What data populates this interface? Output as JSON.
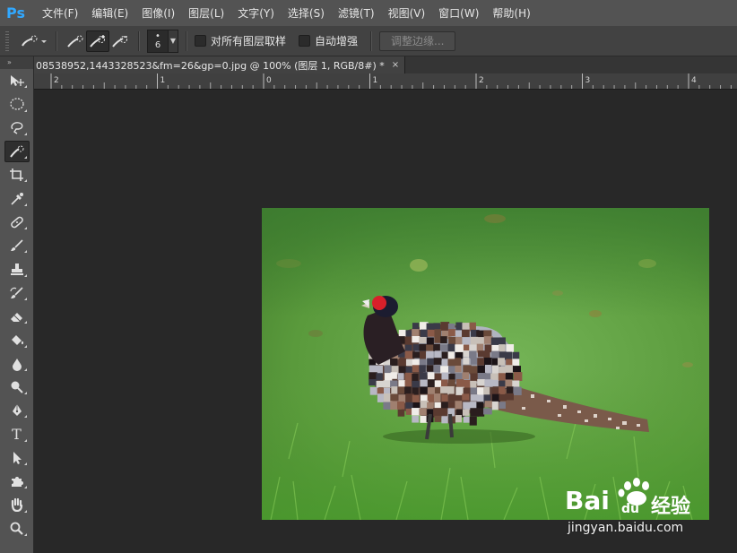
{
  "app": {
    "logo": "Ps"
  },
  "menu": {
    "items": [
      "文件(F)",
      "编辑(E)",
      "图像(I)",
      "图层(L)",
      "文字(Y)",
      "选择(S)",
      "滤镜(T)",
      "视图(V)",
      "窗口(W)",
      "帮助(H)"
    ]
  },
  "options": {
    "brush_size": "6",
    "sample_all_layers": "对所有图层取样",
    "auto_enhance": "自动增强",
    "refine_edge": "调整边缘..."
  },
  "document": {
    "tab_title": "08538952,1443328523&fm=26&gp=0.jpg @ 100% (图层 1, RGB/8#) *",
    "close": "×"
  },
  "ruler": {
    "labels": [
      "2",
      "1",
      "0",
      "1",
      "2",
      "3",
      "4"
    ]
  },
  "toolbar": {
    "header": "»",
    "tools": [
      "move-tool",
      "elliptical-marquee-tool",
      "lasso-tool",
      "quick-selection-tool",
      "crop-tool",
      "eyedropper-tool",
      "spot-healing-brush-tool",
      "brush-tool",
      "clone-stamp-tool",
      "history-brush-tool",
      "eraser-tool",
      "paint-bucket-tool",
      "blur-tool",
      "dodge-tool",
      "pen-tool",
      "type-tool",
      "path-selection-tool",
      "custom-shape-tool",
      "hand-tool",
      "zoom-tool"
    ],
    "type_glyph": "T"
  },
  "watermark": {
    "logo_text": "Bai",
    "logo_text2": "du",
    "logo_cn": "经验",
    "url": "jingyan.baidu.com"
  },
  "colors": {
    "accent": "#31a8ff",
    "panel": "#535353",
    "canvas": "#282828"
  }
}
